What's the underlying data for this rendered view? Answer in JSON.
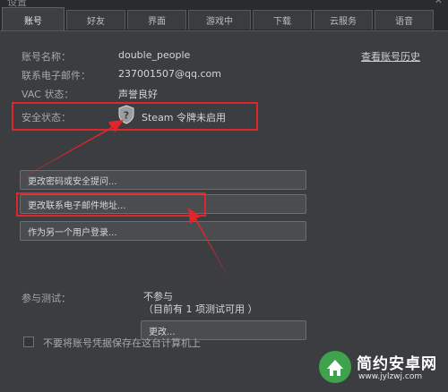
{
  "window": {
    "title": "设置",
    "close_glyph": "✕"
  },
  "tabs": [
    {
      "label": "账号",
      "active": true
    },
    {
      "label": "好友"
    },
    {
      "label": "界面"
    },
    {
      "label": "游戏中"
    },
    {
      "label": "下载"
    },
    {
      "label": "云服务"
    },
    {
      "label": "语音"
    }
  ],
  "account": {
    "name_label": "账号名称：",
    "name_value": "double_people",
    "email_label": "联系电子邮件：",
    "email_value": "237001507@qq.com",
    "vac_label": "VAC 状态：",
    "vac_value": "声誉良好",
    "security_label": "安全状态：",
    "security_value": "Steam 令牌未启用",
    "history_link": "查看账号历史"
  },
  "buttons": {
    "change_password": "更改密码或安全提问...",
    "change_email": "更改联系电子邮件地址...",
    "login_other": "作为另一个用户登录..."
  },
  "beta": {
    "label": "参与测试：",
    "value": "不参与",
    "note": "（目前有 1 项测试可用 ）",
    "change_button": "更改..."
  },
  "remember": {
    "label": "不要将账号凭据保存在这台计算机上"
  },
  "watermark": {
    "brand": "简约安卓网",
    "url": "www.jylzwj.com"
  },
  "colors": {
    "highlight": "#e0252b",
    "panel": "#3b3d40",
    "button": "#4a4c50"
  }
}
